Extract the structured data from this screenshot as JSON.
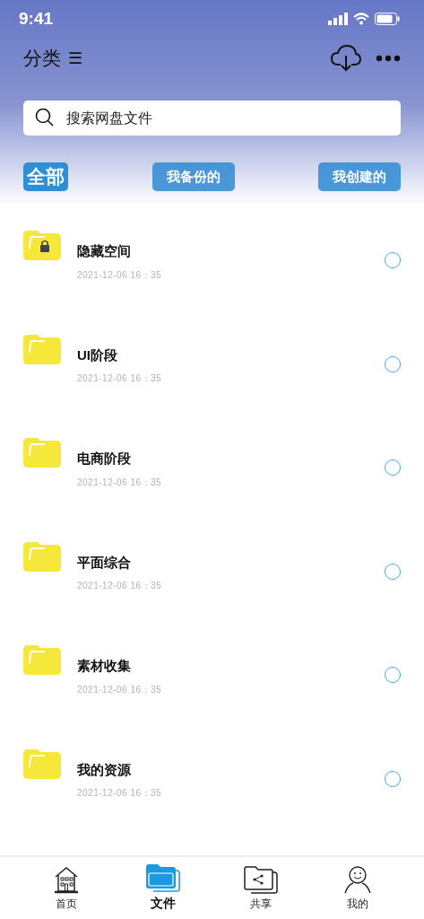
{
  "status_bar": {
    "time": "9:41"
  },
  "header": {
    "title": "分类",
    "menu_glyph": "☰"
  },
  "search": {
    "placeholder": "搜索网盘文件"
  },
  "filters": [
    {
      "label": "全部",
      "selected": true
    },
    {
      "label": "我备份的",
      "selected": false
    },
    {
      "label": "我创建的",
      "selected": false
    }
  ],
  "files": [
    {
      "name": "隐藏空间",
      "date": "2021-12-06 16：35",
      "locked": true,
      "selected": false
    },
    {
      "name": "UI阶段",
      "date": "2021-12-06 16：35",
      "locked": false,
      "selected": false
    },
    {
      "name": "电商阶段",
      "date": "2021-12-06 16：35",
      "locked": false,
      "selected": false
    },
    {
      "name": "平面综合",
      "date": "2021-12-06 16：35",
      "locked": false,
      "selected": false
    },
    {
      "name": "素材收集",
      "date": "2021-12-06 16：35",
      "locked": false,
      "selected": false
    },
    {
      "name": "我的资源",
      "date": "2021-12-06 16：35",
      "locked": false,
      "selected": false
    }
  ],
  "bottom_nav": [
    {
      "label": "首页",
      "kind": "home",
      "selected": false
    },
    {
      "label": "文件",
      "kind": "files",
      "selected": true
    },
    {
      "label": "共享",
      "kind": "share",
      "selected": false
    },
    {
      "label": "我的",
      "kind": "profile",
      "selected": false
    }
  ]
}
